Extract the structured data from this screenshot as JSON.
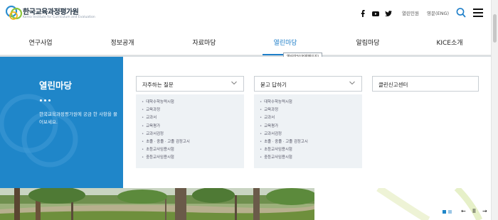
{
  "header": {
    "logo_name": "한국교육과정평가원",
    "logo_sub": "Korea Institute for Curriculum and Evaluation",
    "sns": [
      "facebook-icon",
      "youtube-icon",
      "twitter-icon"
    ],
    "utility_links": [
      "열린민원",
      "영문(ENG)"
    ]
  },
  "gnb": {
    "items": [
      "연구사업",
      "정보공개",
      "자료마당",
      "열린마당",
      "알림마당",
      "KICE소개"
    ],
    "active": "열린마당",
    "tooltip": "열린마당(현재페이지)"
  },
  "mega": {
    "title": "열린마당",
    "description": "한국교육과정평가원에 궁금 한 사항을 물어보세요.",
    "columns": [
      {
        "label": "자주하는 질문",
        "items": [
          "대학수학능력시험",
          "교육과정",
          "교과서",
          "교육평가",
          "교과서검정",
          "초졸 · 중졸 · 고졸 검정고시",
          "초등교사임용시험",
          "중등교사임용시험"
        ]
      },
      {
        "label": "묻고 답하기",
        "items": [
          "대학수학능력시험",
          "교육과정",
          "교과서",
          "교육평가",
          "교과서검정",
          "초졸 · 중졸 · 고졸 검정고시",
          "초등교사임용시험",
          "중등교사임용시험"
        ]
      }
    ],
    "clean_center": "클린신고센터"
  },
  "slider": {
    "prev": "←",
    "pause": "II",
    "next": "→"
  },
  "colors": {
    "accent": "#1f86c9",
    "active_text": "#1f7fc9"
  }
}
